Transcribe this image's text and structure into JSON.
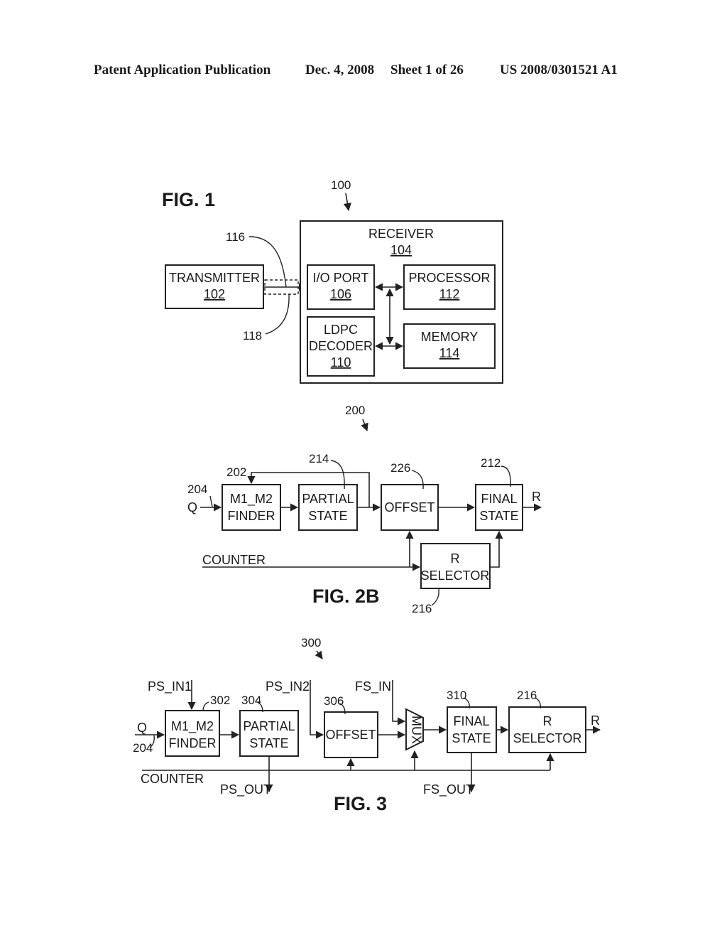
{
  "header": {
    "publication": "Patent Application Publication",
    "date": "Dec. 4, 2008",
    "sheet": "Sheet 1 of 26",
    "number": "US 2008/0301521 A1"
  },
  "fig1": {
    "title": "FIG. 1",
    "ref": "100",
    "transmitter": {
      "label": "TRANSMITTER",
      "ref": "102"
    },
    "receiver": {
      "label": "RECEIVER",
      "ref": "104"
    },
    "io_port": {
      "label": "I/O PORT",
      "ref": "106"
    },
    "processor": {
      "label": "PROCESSOR",
      "ref": "112"
    },
    "ldpc": {
      "label1": "LDPC",
      "label2": "DECODER",
      "ref": "110"
    },
    "memory": {
      "label": "MEMORY",
      "ref": "114"
    },
    "link_ref_a": "116",
    "link_ref_b": "118"
  },
  "fig2b": {
    "title": "FIG. 2B",
    "ref": "200",
    "input_ref": "204",
    "input_label": "Q",
    "finder": {
      "label1": "M1_M2",
      "label2": "FINDER",
      "ref": "202"
    },
    "partial": {
      "label1": "PARTIAL",
      "label2": "STATE",
      "ref": "214"
    },
    "offset": {
      "label": "OFFSET",
      "ref": "226"
    },
    "final": {
      "label1": "FINAL",
      "label2": "STATE",
      "ref": "212"
    },
    "rsel": {
      "label1": "R",
      "label2": "SELECTOR",
      "ref": "216"
    },
    "counter": "COUNTER",
    "output": "R"
  },
  "fig3": {
    "title": "FIG. 3",
    "ref": "300",
    "input_label": "Q",
    "input_ref": "204",
    "ps_in1": "PS_IN1",
    "ps_in2": "PS_IN2",
    "fs_in": "FS_IN",
    "ps_out": "PS_OUT",
    "fs_out": "FS_OUT",
    "counter": "COUNTER",
    "output": "R",
    "finder": {
      "label1": "M1_M2",
      "label2": "FINDER",
      "ref": "302"
    },
    "partial": {
      "label1": "PARTIAL",
      "label2": "STATE",
      "ref": "304"
    },
    "offset": {
      "label": "OFFSET",
      "ref": "306"
    },
    "mux": {
      "label": "MUX"
    },
    "final": {
      "label1": "FINAL",
      "label2": "STATE",
      "ref": "310"
    },
    "rsel": {
      "label1": "R",
      "label2": "SELECTOR",
      "ref": "216"
    }
  }
}
